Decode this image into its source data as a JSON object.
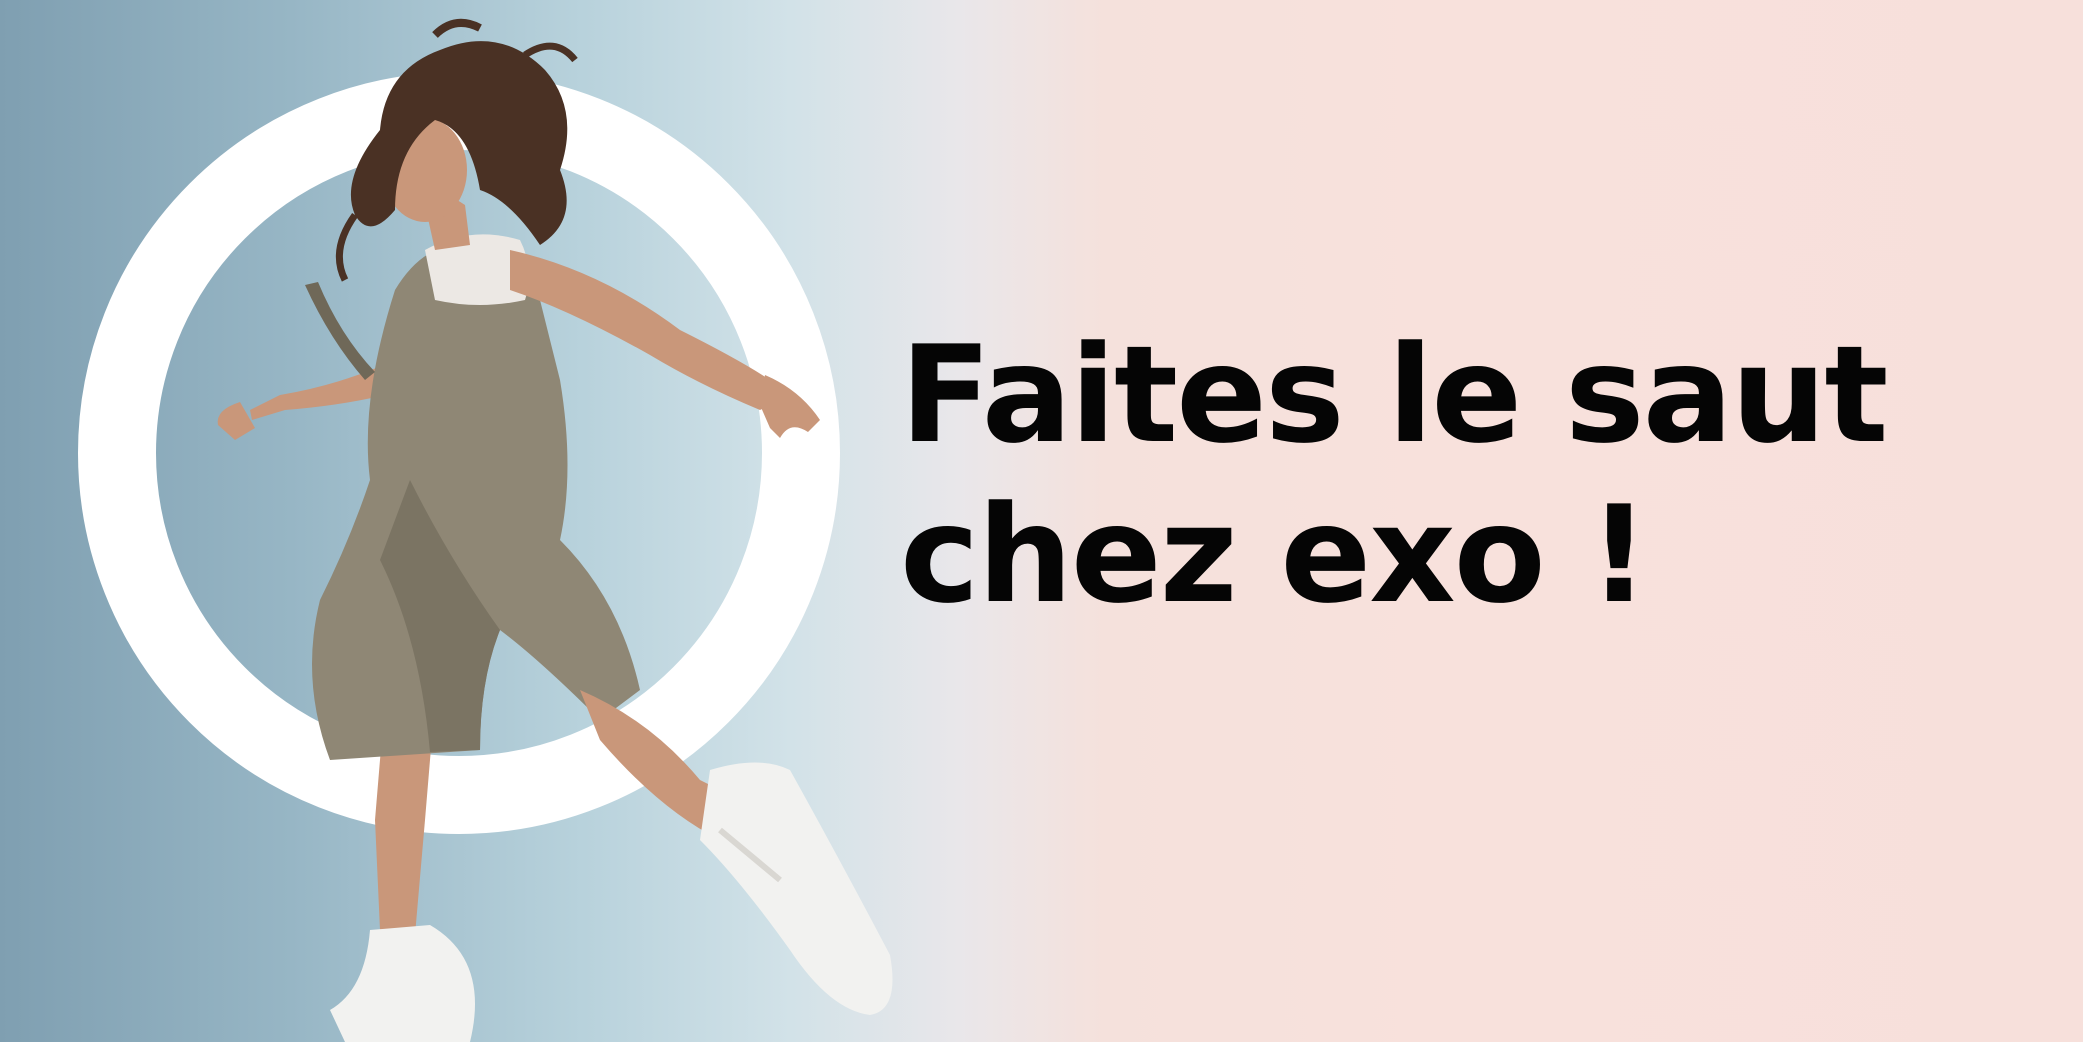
{
  "headline": {
    "line1": "Faites le saut",
    "line2": "chez exo !"
  },
  "colors": {
    "background_left": "#7f9fb1",
    "background_mid": "#d2e2e8",
    "background_right": "#f7e0db",
    "ring": "#ffffff",
    "headline_text": "#050505",
    "jumpsuit": "#8f8775",
    "skin": "#c9977a",
    "hair": "#4a3124",
    "sneakers": "#f2f2f0"
  }
}
